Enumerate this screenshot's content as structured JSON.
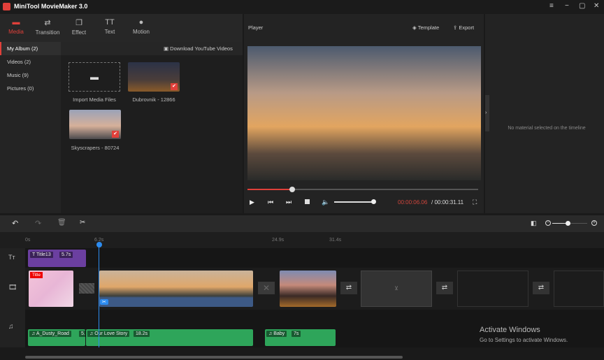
{
  "app": {
    "title": "MiniTool MovieMaker 3.0",
    "min": "−",
    "menu": "≡",
    "max": "▢",
    "close": "✕"
  },
  "toolbar": [
    {
      "label": "Media",
      "icon": "folder-icon",
      "glyph": "▬"
    },
    {
      "label": "Transition",
      "icon": "transition-icon",
      "glyph": "⇄"
    },
    {
      "label": "Effect",
      "icon": "effect-icon",
      "glyph": "❐"
    },
    {
      "label": "Text",
      "icon": "text-icon",
      "glyph": "TT"
    },
    {
      "label": "Motion",
      "icon": "motion-icon",
      "glyph": "●"
    }
  ],
  "sidebar": [
    "My Album (2)",
    "Videos (2)",
    "Music (9)",
    "Pictures (0)"
  ],
  "media": {
    "download": "Download YouTube Videos",
    "import": "Import Media Files",
    "items": [
      "Dubrovnik - 12866",
      "Skyscrapers - 80724"
    ]
  },
  "player": {
    "title": "Player",
    "template": "Template",
    "export": "Export",
    "progress": 0.195,
    "volume": 1.0,
    "current": "00:00:06.06",
    "total": "/ 00:00:31.11"
  },
  "properties": {
    "empty": "No material selected on the timeline"
  },
  "timeline": {
    "ruler": [
      "0s",
      "6.2s",
      "24.9s",
      "31.4s"
    ],
    "zoom": 0.45,
    "title_clip": {
      "name": "Title13",
      "dur": "5.7s"
    },
    "title_badge": "Title",
    "audio": [
      {
        "name": "A_Dusty_Road",
        "dur": "5."
      },
      {
        "name": "Our Love Story",
        "dur": "18.2s"
      },
      {
        "name": "Baby",
        "dur": "7s"
      }
    ]
  },
  "watermark": {
    "line1": "Activate Windows",
    "line2": "Go to Settings to activate Windows."
  },
  "colors": {
    "accent": "#e0403a",
    "playhead": "#2d8cf0",
    "title": "#6b3fa0",
    "audio": "#2ea55a"
  }
}
